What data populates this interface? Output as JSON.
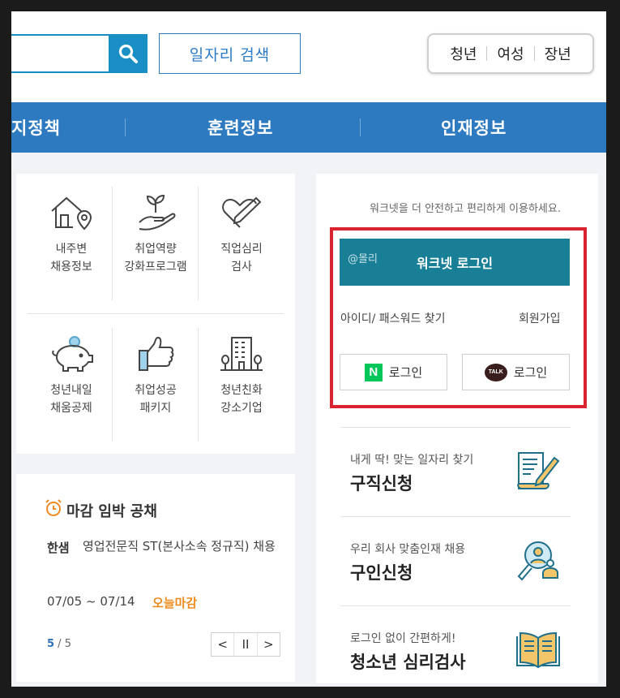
{
  "header": {
    "job_search_label": "일자리 검색",
    "target_groups": [
      "청년",
      "여성",
      "장년"
    ]
  },
  "nav": {
    "items": [
      "지정책",
      "훈련정보",
      "인재정보"
    ]
  },
  "services": {
    "items": [
      {
        "line1": "내주변",
        "line2": "채용정보",
        "icon": "house-location-icon"
      },
      {
        "line1": "취업역량",
        "line2": "강화프로그램",
        "icon": "sprout-hand-icon"
      },
      {
        "line1": "직업심리",
        "line2": "검사",
        "icon": "heart-pen-icon"
      },
      {
        "line1": "청년내일",
        "line2": "채움공제",
        "icon": "piggy-bank-icon"
      },
      {
        "line1": "취업성공",
        "line2": "패키지",
        "icon": "thumbs-up-icon"
      },
      {
        "line1": "청년친화",
        "line2": "강소기업",
        "icon": "building-icon"
      }
    ]
  },
  "deadline": {
    "title": "마감 임박 공채",
    "company": "한샘",
    "job": "영업전문직 ST(본사소속 정규직) 채용",
    "date_range": "07/05 ~ 07/14",
    "tag": "오늘마감",
    "page_current": "5",
    "page_sep": " / ",
    "page_total": "5",
    "pager": {
      "prev": "<",
      "pause": "II",
      "next": ">"
    }
  },
  "login": {
    "notice": "워크넷을 더 안전하고 편리하게 이용하세요.",
    "watermark": "@몰리",
    "worknet_login_label": "워크넷 로그인",
    "find_label": "아이디/ 패스워드 찾기",
    "signup_label": "회원가입",
    "naver_icon_text": "N",
    "kakao_icon_text": "TALK",
    "naver_login_label": "로그인",
    "kakao_login_label": "로그인",
    "highlight_color": "#d9232e"
  },
  "quick_services": [
    {
      "sub": "내게 딱! 맞는 일자리 찾기",
      "main": "구직신청",
      "icon": "document-pen-icon"
    },
    {
      "sub": "우리 회사 맞춤인재 채용",
      "main": "구인신청",
      "icon": "magnifier-person-icon"
    },
    {
      "sub": "로그인 없이 간편하게!",
      "main": "청소년 심리검사",
      "icon": "open-book-icon"
    }
  ],
  "colors": {
    "nav_bg": "#2e7ac1",
    "search_accent": "#1a8fc6",
    "login_btn": "#197f96",
    "naver_green": "#03c75a",
    "deadline_tag": "#ef8a1f"
  }
}
